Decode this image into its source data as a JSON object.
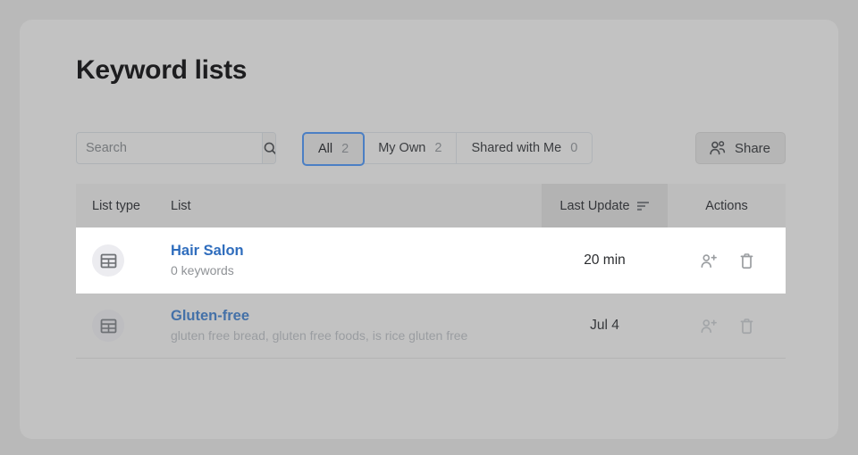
{
  "page": {
    "title": "Keyword lists",
    "background_color": "#b9b9b9",
    "card_color": "#c2c2c2",
    "accent_color": "#2f6dbd",
    "selected_tab_border_color": "#4b7fc4"
  },
  "search": {
    "placeholder": "Search",
    "value": "",
    "icon": "search-icon"
  },
  "filters": [
    {
      "label": "All",
      "count": "2",
      "active": true
    },
    {
      "label": "My Own",
      "count": "2",
      "active": false
    },
    {
      "label": "Shared with Me",
      "count": "0",
      "active": false
    }
  ],
  "share_button": {
    "label": "Share",
    "icon": "users-icon"
  },
  "table": {
    "columns": {
      "list_type": "List type",
      "list": "List",
      "last_update": "Last Update",
      "actions": "Actions"
    },
    "sort": {
      "column": "Last Update",
      "direction": "descending",
      "icon": "sort-descending-icon"
    },
    "rows": [
      {
        "type_icon": "table-grid-icon",
        "name": "Hair Salon",
        "subtitle": "0 keywords",
        "last_update": "20 min",
        "highlighted": true,
        "actions": [
          {
            "name": "share-list",
            "icon": "user-plus-icon"
          },
          {
            "name": "delete-list",
            "icon": "trash-icon"
          }
        ]
      },
      {
        "type_icon": "table-grid-icon",
        "name": "Gluten-free",
        "subtitle": "gluten free bread, gluten free foods, is rice gluten free",
        "last_update": "Jul 4",
        "highlighted": false,
        "actions": [
          {
            "name": "share-list",
            "icon": "user-plus-icon"
          },
          {
            "name": "delete-list",
            "icon": "trash-icon"
          }
        ]
      }
    ]
  }
}
